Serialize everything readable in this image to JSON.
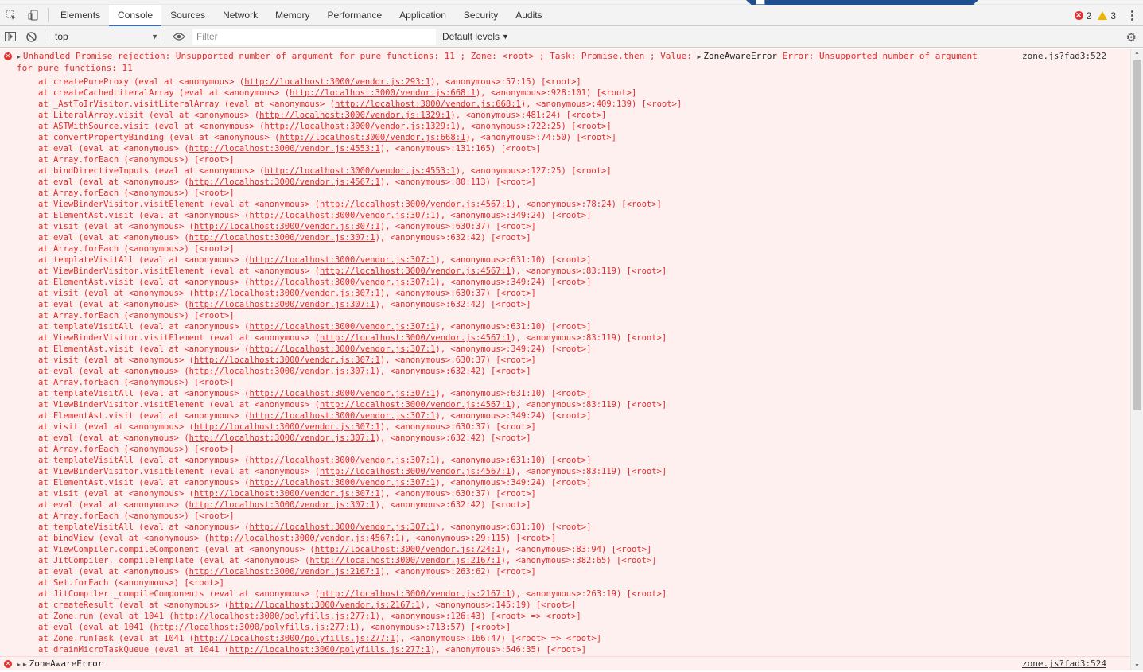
{
  "tabs": [
    "Elements",
    "Console",
    "Sources",
    "Network",
    "Memory",
    "Performance",
    "Application",
    "Security",
    "Audits"
  ],
  "active_tab": "Console",
  "counts": {
    "errors": "2",
    "warnings": "3"
  },
  "filterbar": {
    "context": "top",
    "filter_placeholder": "Filter",
    "levels_label": "Default levels"
  },
  "messages": [
    {
      "summary": "Unhandled Promise rejection: Unsupported number of argument for pure functions: 11 ; Zone: <root> ; Task: Promise.then ; Value: ",
      "object_label": "ZoneAwareError",
      "summary_tail": " Error: Unsupported number of argument for pure functions: 11",
      "source": "zone.js?fad3:522"
    },
    {
      "object_label": "ZoneAwareError",
      "source": "zone.js?fad3:524"
    }
  ],
  "stack": [
    {
      "pre": "at createPureProxy (eval at <anonymous> (",
      "url": "http://localhost:3000/vendor.js:293:1",
      "post": "), <anonymous>:57:15) [<root>]"
    },
    {
      "pre": "at createCachedLiteralArray (eval at <anonymous> (",
      "url": "http://localhost:3000/vendor.js:668:1",
      "post": "), <anonymous>:928:101) [<root>]"
    },
    {
      "pre": "at _AstToIrVisitor.visitLiteralArray (eval at <anonymous> (",
      "url": "http://localhost:3000/vendor.js:668:1",
      "post": "), <anonymous>:409:139) [<root>]"
    },
    {
      "pre": "at LiteralArray.visit (eval at <anonymous> (",
      "url": "http://localhost:3000/vendor.js:1329:1",
      "post": "), <anonymous>:481:24) [<root>]"
    },
    {
      "pre": "at ASTWithSource.visit (eval at <anonymous> (",
      "url": "http://localhost:3000/vendor.js:1329:1",
      "post": "), <anonymous>:722:25) [<root>]"
    },
    {
      "pre": "at convertPropertyBinding (eval at <anonymous> (",
      "url": "http://localhost:3000/vendor.js:668:1",
      "post": "), <anonymous>:74:50) [<root>]"
    },
    {
      "pre": "at eval (eval at <anonymous> (",
      "url": "http://localhost:3000/vendor.js:4553:1",
      "post": "), <anonymous>:131:165) [<root>]"
    },
    {
      "pre": "at Array.forEach (<anonymous>) [<root>]",
      "url": "",
      "post": ""
    },
    {
      "pre": "at bindDirectiveInputs (eval at <anonymous> (",
      "url": "http://localhost:3000/vendor.js:4553:1",
      "post": "), <anonymous>:127:25) [<root>]"
    },
    {
      "pre": "at eval (eval at <anonymous> (",
      "url": "http://localhost:3000/vendor.js:4567:1",
      "post": "), <anonymous>:80:113) [<root>]"
    },
    {
      "pre": "at Array.forEach (<anonymous>) [<root>]",
      "url": "",
      "post": ""
    },
    {
      "pre": "at ViewBinderVisitor.visitElement (eval at <anonymous> (",
      "url": "http://localhost:3000/vendor.js:4567:1",
      "post": "), <anonymous>:78:24) [<root>]"
    },
    {
      "pre": "at ElementAst.visit (eval at <anonymous> (",
      "url": "http://localhost:3000/vendor.js:307:1",
      "post": "), <anonymous>:349:24) [<root>]"
    },
    {
      "pre": "at visit (eval at <anonymous> (",
      "url": "http://localhost:3000/vendor.js:307:1",
      "post": "), <anonymous>:630:37) [<root>]"
    },
    {
      "pre": "at eval (eval at <anonymous> (",
      "url": "http://localhost:3000/vendor.js:307:1",
      "post": "), <anonymous>:632:42) [<root>]"
    },
    {
      "pre": "at Array.forEach (<anonymous>) [<root>]",
      "url": "",
      "post": ""
    },
    {
      "pre": "at templateVisitAll (eval at <anonymous> (",
      "url": "http://localhost:3000/vendor.js:307:1",
      "post": "), <anonymous>:631:10) [<root>]"
    },
    {
      "pre": "at ViewBinderVisitor.visitElement (eval at <anonymous> (",
      "url": "http://localhost:3000/vendor.js:4567:1",
      "post": "), <anonymous>:83:119) [<root>]"
    },
    {
      "pre": "at ElementAst.visit (eval at <anonymous> (",
      "url": "http://localhost:3000/vendor.js:307:1",
      "post": "), <anonymous>:349:24) [<root>]"
    },
    {
      "pre": "at visit (eval at <anonymous> (",
      "url": "http://localhost:3000/vendor.js:307:1",
      "post": "), <anonymous>:630:37) [<root>]"
    },
    {
      "pre": "at eval (eval at <anonymous> (",
      "url": "http://localhost:3000/vendor.js:307:1",
      "post": "), <anonymous>:632:42) [<root>]"
    },
    {
      "pre": "at Array.forEach (<anonymous>) [<root>]",
      "url": "",
      "post": ""
    },
    {
      "pre": "at templateVisitAll (eval at <anonymous> (",
      "url": "http://localhost:3000/vendor.js:307:1",
      "post": "), <anonymous>:631:10) [<root>]"
    },
    {
      "pre": "at ViewBinderVisitor.visitElement (eval at <anonymous> (",
      "url": "http://localhost:3000/vendor.js:4567:1",
      "post": "), <anonymous>:83:119) [<root>]"
    },
    {
      "pre": "at ElementAst.visit (eval at <anonymous> (",
      "url": "http://localhost:3000/vendor.js:307:1",
      "post": "), <anonymous>:349:24) [<root>]"
    },
    {
      "pre": "at visit (eval at <anonymous> (",
      "url": "http://localhost:3000/vendor.js:307:1",
      "post": "), <anonymous>:630:37) [<root>]"
    },
    {
      "pre": "at eval (eval at <anonymous> (",
      "url": "http://localhost:3000/vendor.js:307:1",
      "post": "), <anonymous>:632:42) [<root>]"
    },
    {
      "pre": "at Array.forEach (<anonymous>) [<root>]",
      "url": "",
      "post": ""
    },
    {
      "pre": "at templateVisitAll (eval at <anonymous> (",
      "url": "http://localhost:3000/vendor.js:307:1",
      "post": "), <anonymous>:631:10) [<root>]"
    },
    {
      "pre": "at ViewBinderVisitor.visitElement (eval at <anonymous> (",
      "url": "http://localhost:3000/vendor.js:4567:1",
      "post": "), <anonymous>:83:119) [<root>]"
    },
    {
      "pre": "at ElementAst.visit (eval at <anonymous> (",
      "url": "http://localhost:3000/vendor.js:307:1",
      "post": "), <anonymous>:349:24) [<root>]"
    },
    {
      "pre": "at visit (eval at <anonymous> (",
      "url": "http://localhost:3000/vendor.js:307:1",
      "post": "), <anonymous>:630:37) [<root>]"
    },
    {
      "pre": "at eval (eval at <anonymous> (",
      "url": "http://localhost:3000/vendor.js:307:1",
      "post": "), <anonymous>:632:42) [<root>]"
    },
    {
      "pre": "at Array.forEach (<anonymous>) [<root>]",
      "url": "",
      "post": ""
    },
    {
      "pre": "at templateVisitAll (eval at <anonymous> (",
      "url": "http://localhost:3000/vendor.js:307:1",
      "post": "), <anonymous>:631:10) [<root>]"
    },
    {
      "pre": "at ViewBinderVisitor.visitElement (eval at <anonymous> (",
      "url": "http://localhost:3000/vendor.js:4567:1",
      "post": "), <anonymous>:83:119) [<root>]"
    },
    {
      "pre": "at ElementAst.visit (eval at <anonymous> (",
      "url": "http://localhost:3000/vendor.js:307:1",
      "post": "), <anonymous>:349:24) [<root>]"
    },
    {
      "pre": "at visit (eval at <anonymous> (",
      "url": "http://localhost:3000/vendor.js:307:1",
      "post": "), <anonymous>:630:37) [<root>]"
    },
    {
      "pre": "at eval (eval at <anonymous> (",
      "url": "http://localhost:3000/vendor.js:307:1",
      "post": "), <anonymous>:632:42) [<root>]"
    },
    {
      "pre": "at Array.forEach (<anonymous>) [<root>]",
      "url": "",
      "post": ""
    },
    {
      "pre": "at templateVisitAll (eval at <anonymous> (",
      "url": "http://localhost:3000/vendor.js:307:1",
      "post": "), <anonymous>:631:10) [<root>]"
    },
    {
      "pre": "at bindView (eval at <anonymous> (",
      "url": "http://localhost:3000/vendor.js:4567:1",
      "post": "), <anonymous>:29:115) [<root>]"
    },
    {
      "pre": "at ViewCompiler.compileComponent (eval at <anonymous> (",
      "url": "http://localhost:3000/vendor.js:724:1",
      "post": "), <anonymous>:83:94) [<root>]"
    },
    {
      "pre": "at JitCompiler._compileTemplate (eval at <anonymous> (",
      "url": "http://localhost:3000/vendor.js:2167:1",
      "post": "), <anonymous>:382:65) [<root>]"
    },
    {
      "pre": "at eval (eval at <anonymous> (",
      "url": "http://localhost:3000/vendor.js:2167:1",
      "post": "), <anonymous>:263:62) [<root>]"
    },
    {
      "pre": "at Set.forEach (<anonymous>) [<root>]",
      "url": "",
      "post": ""
    },
    {
      "pre": "at JitCompiler._compileComponents (eval at <anonymous> (",
      "url": "http://localhost:3000/vendor.js:2167:1",
      "post": "), <anonymous>:263:19) [<root>]"
    },
    {
      "pre": "at createResult (eval at <anonymous> (",
      "url": "http://localhost:3000/vendor.js:2167:1",
      "post": "), <anonymous>:145:19) [<root>]"
    },
    {
      "pre": "at Zone.run (eval at 1041 (",
      "url": "http://localhost:3000/polyfills.js:277:1",
      "post": "), <anonymous>:126:43) [<root> => <root>]"
    },
    {
      "pre": "at eval (eval at 1041 (",
      "url": "http://localhost:3000/polyfills.js:277:1",
      "post": "), <anonymous>:713:57) [<root>]"
    },
    {
      "pre": "at Zone.runTask (eval at 1041 (",
      "url": "http://localhost:3000/polyfills.js:277:1",
      "post": "), <anonymous>:166:47) [<root> => <root>]"
    },
    {
      "pre": "at drainMicroTaskQueue (eval at 1041 (",
      "url": "http://localhost:3000/polyfills.js:277:1",
      "post": "), <anonymous>:546:35) [<root>]"
    }
  ],
  "icons": {
    "inspect": "inspect-element-icon",
    "device": "device-toolbar-icon",
    "sidebar": "show-sidebar-icon",
    "clear": "clear-console-icon",
    "eye": "live-expression-icon",
    "settings": "gear-icon",
    "more": "kebab-menu-icon",
    "error": "error-icon"
  },
  "colors": {
    "error_text": "#e02d2d",
    "error_bg": "#fff0f0",
    "accent": "#1a73e8"
  }
}
